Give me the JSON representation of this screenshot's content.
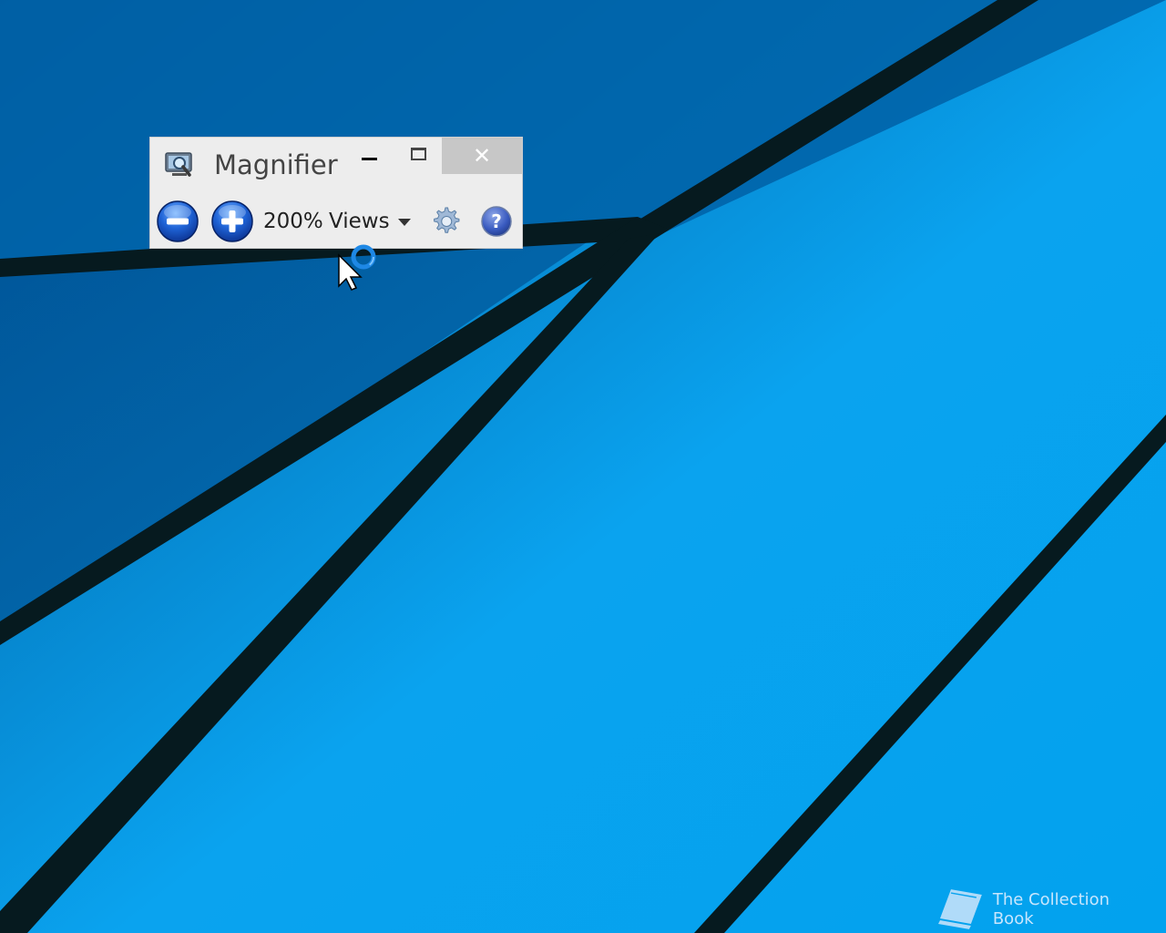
{
  "window": {
    "title": "Magnifier",
    "zoom_level": "200%",
    "views_label": "Views"
  },
  "icons": {
    "app": "magnifier-app-icon",
    "minimize": "minimize-icon",
    "maximize": "maximize-icon",
    "close": "close-icon",
    "zoom_out": "zoom-out-icon",
    "zoom_in": "zoom-in-icon",
    "views_dropdown": "chevron-down-icon",
    "settings": "gear-icon",
    "help": "help-icon",
    "cursor": "busy-cursor-icon"
  },
  "watermark": {
    "text": "The Collection Book"
  },
  "colors": {
    "desktop_light": "#0aa3ef",
    "desktop_dark": "#005c9f",
    "stripe": "#061a1f",
    "window_bg": "#ededed",
    "close_button": "#c7c7c7"
  }
}
